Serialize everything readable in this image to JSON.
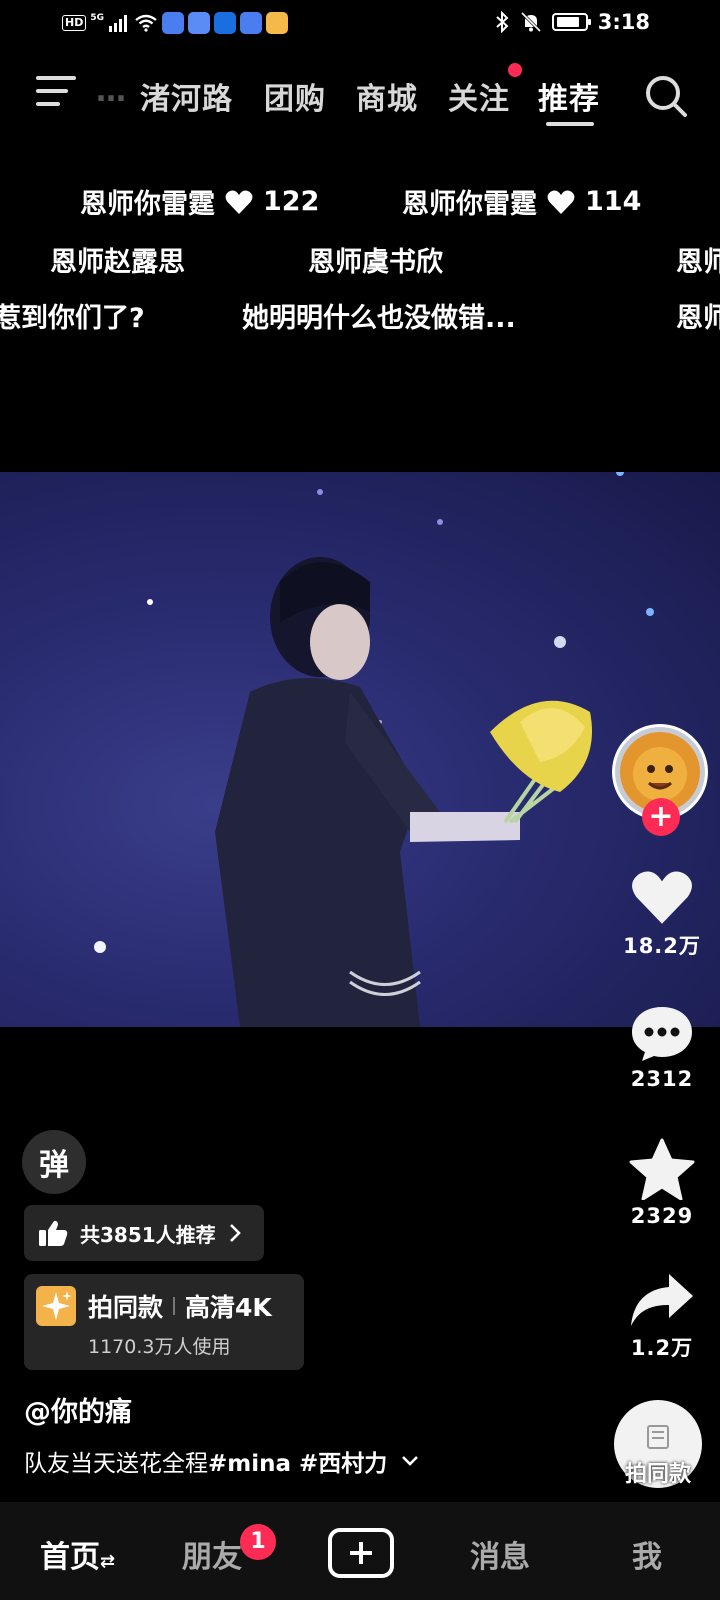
{
  "status_bar": {
    "hd": "HD",
    "network": "5G",
    "time": "3:18"
  },
  "top_nav": {
    "tabs": [
      "渚河路",
      "团购",
      "商城",
      "关注",
      "推荐"
    ],
    "active_tab": "推荐"
  },
  "danmaku": [
    {
      "text": "恩师你雷霆",
      "likes": "122"
    },
    {
      "text": "恩师你雷霆",
      "likes": "114"
    },
    {
      "text": "恩师赵露思"
    },
    {
      "text": "恩师虞书欣"
    },
    {
      "text": "恩师"
    },
    {
      "text": "惹到你们了?"
    },
    {
      "text": "她明明什么也没做错..."
    },
    {
      "text": "恩师"
    }
  ],
  "sidebar": {
    "likes": "18.2万",
    "comments": "2312",
    "favorites": "2329",
    "shares": "1.2万"
  },
  "info": {
    "danmu_toggle": "弹",
    "recommend": "共3851人推荐",
    "template_title": "拍同款",
    "template_quality": "高清4K",
    "template_usage": "1170.3万人使用",
    "author": "@你的痛",
    "caption": "队友当天送花全程",
    "caption_tags": "#mina #西村力",
    "music_label": "拍同款"
  },
  "tab_bar": {
    "tabs": [
      "首页",
      "朋友",
      "消息",
      "我"
    ],
    "friends_badge": "1"
  },
  "colors": {
    "accent": "#fe2c55",
    "background": "#000000",
    "video_tint": "#2b2d75"
  }
}
